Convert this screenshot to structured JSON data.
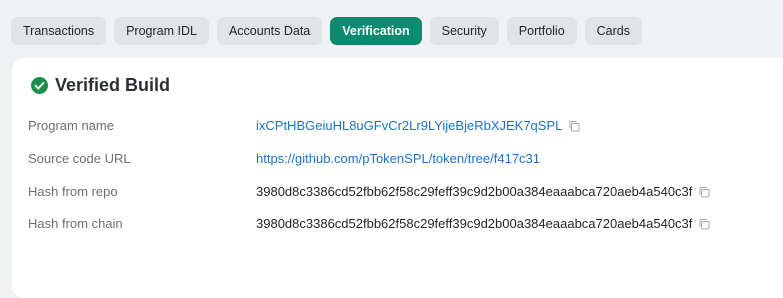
{
  "tabs": [
    {
      "label": "Transactions",
      "active": false
    },
    {
      "label": "Program IDL",
      "active": false
    },
    {
      "label": "Accounts Data",
      "active": false
    },
    {
      "label": "Verification",
      "active": true
    },
    {
      "label": "Security",
      "active": false
    },
    {
      "label": "Portfolio",
      "active": false
    },
    {
      "label": "Cards",
      "active": false
    }
  ],
  "card": {
    "title": "Verified Build",
    "rows": [
      {
        "label": "Program name",
        "value": "ixCPtHBGeiuHL8uGFvCr2Lr9LYijeBjeRbXJEK7qSPL"
      },
      {
        "label": "Source code URL",
        "value": "https://github.com/pTokenSPL/token/tree/f417c31"
      },
      {
        "label": "Hash from repo",
        "value": "3980d8c3386cd52fbb62f58c29feff39c9d2b00a384eaaabca720aeb4a540c3f"
      },
      {
        "label": "Hash from chain",
        "value": "3980d8c3386cd52fbb62f58c29feff39c9d2b00a384eaaabca720aeb4a540c3f"
      }
    ]
  },
  "colors": {
    "accent": "#0a8a6f",
    "link": "#1a73c8",
    "verified_icon": "#1e8e4a"
  },
  "icons": {
    "verified": "check-circle-icon",
    "copy": "copy-icon"
  }
}
